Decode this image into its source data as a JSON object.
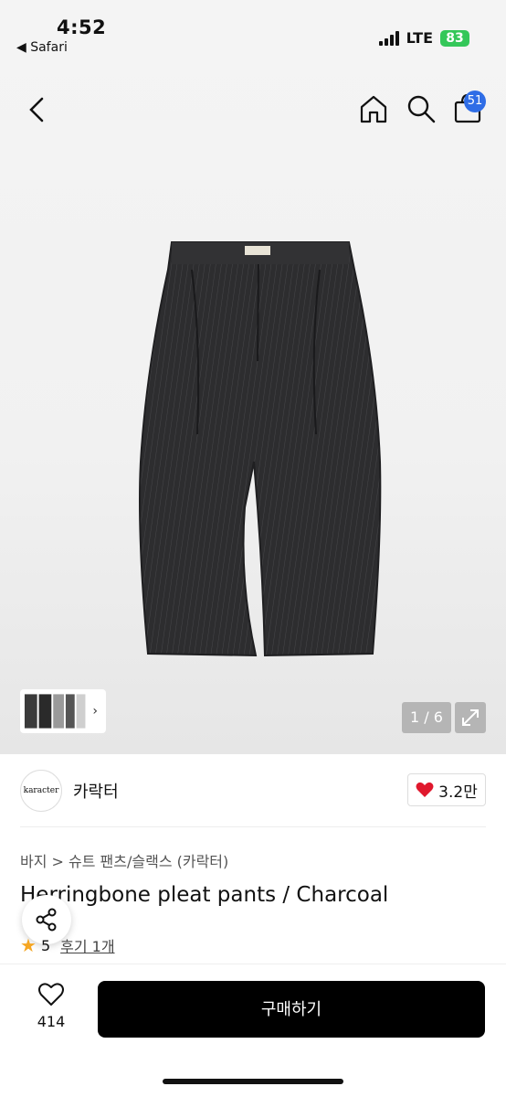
{
  "status_bar": {
    "time": "4:52",
    "back_app": "◀ Safari",
    "network": "LTE",
    "battery": "83"
  },
  "nav": {
    "back_icon": "chevron-left-icon",
    "home_icon": "home-icon",
    "search_icon": "search-icon",
    "cart_icon": "shopping-bag-icon",
    "cart_count": "51"
  },
  "gallery": {
    "page_indicator": "1 / 6",
    "thumb_arrow": "›"
  },
  "brand": {
    "logo_text": "karacter",
    "name": "카락터",
    "likes": "3.2만"
  },
  "product": {
    "breadcrumb": "바지 > 슈트 팬츠/슬랙스 (카락터)",
    "title": "Herringbone pleat pants / Charcoal",
    "rating": "5",
    "reviews": "후기 1개"
  },
  "bottom": {
    "wish_count": "414",
    "buy_label": "구매하기"
  },
  "colors": {
    "accent_badge": "#2f6de6",
    "battery": "#34c759",
    "buy_button": "#000000",
    "heart": "#e0182d"
  }
}
